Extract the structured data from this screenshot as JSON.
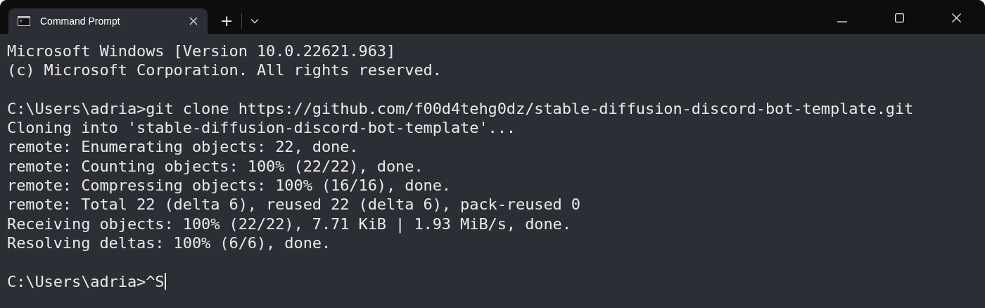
{
  "window": {
    "title": "Command Prompt"
  },
  "tab_bar": {
    "new_tab": "+"
  },
  "terminal": {
    "blocks": [
      [
        "Microsoft Windows [Version 10.0.22621.963]",
        "(c) Microsoft Corporation. All rights reserved."
      ],
      [
        "C:\\Users\\adria>git clone https://github.com/f00d4tehg0dz/stable-diffusion-discord-bot-template.git",
        "Cloning into 'stable-diffusion-discord-bot-template'...",
        "remote: Enumerating objects: 22, done.",
        "remote: Counting objects: 100% (22/22), done.",
        "remote: Compressing objects: 100% (16/16), done.",
        "remote: Total 22 (delta 6), reused 22 (delta 6), pack-reused 0",
        "Receiving objects: 100% (22/22), 7.71 KiB | 1.93 MiB/s, done.",
        "Resolving deltas: 100% (6/6), done."
      ],
      [
        "C:\\Users\\adria>^S"
      ]
    ],
    "cursor": true
  }
}
